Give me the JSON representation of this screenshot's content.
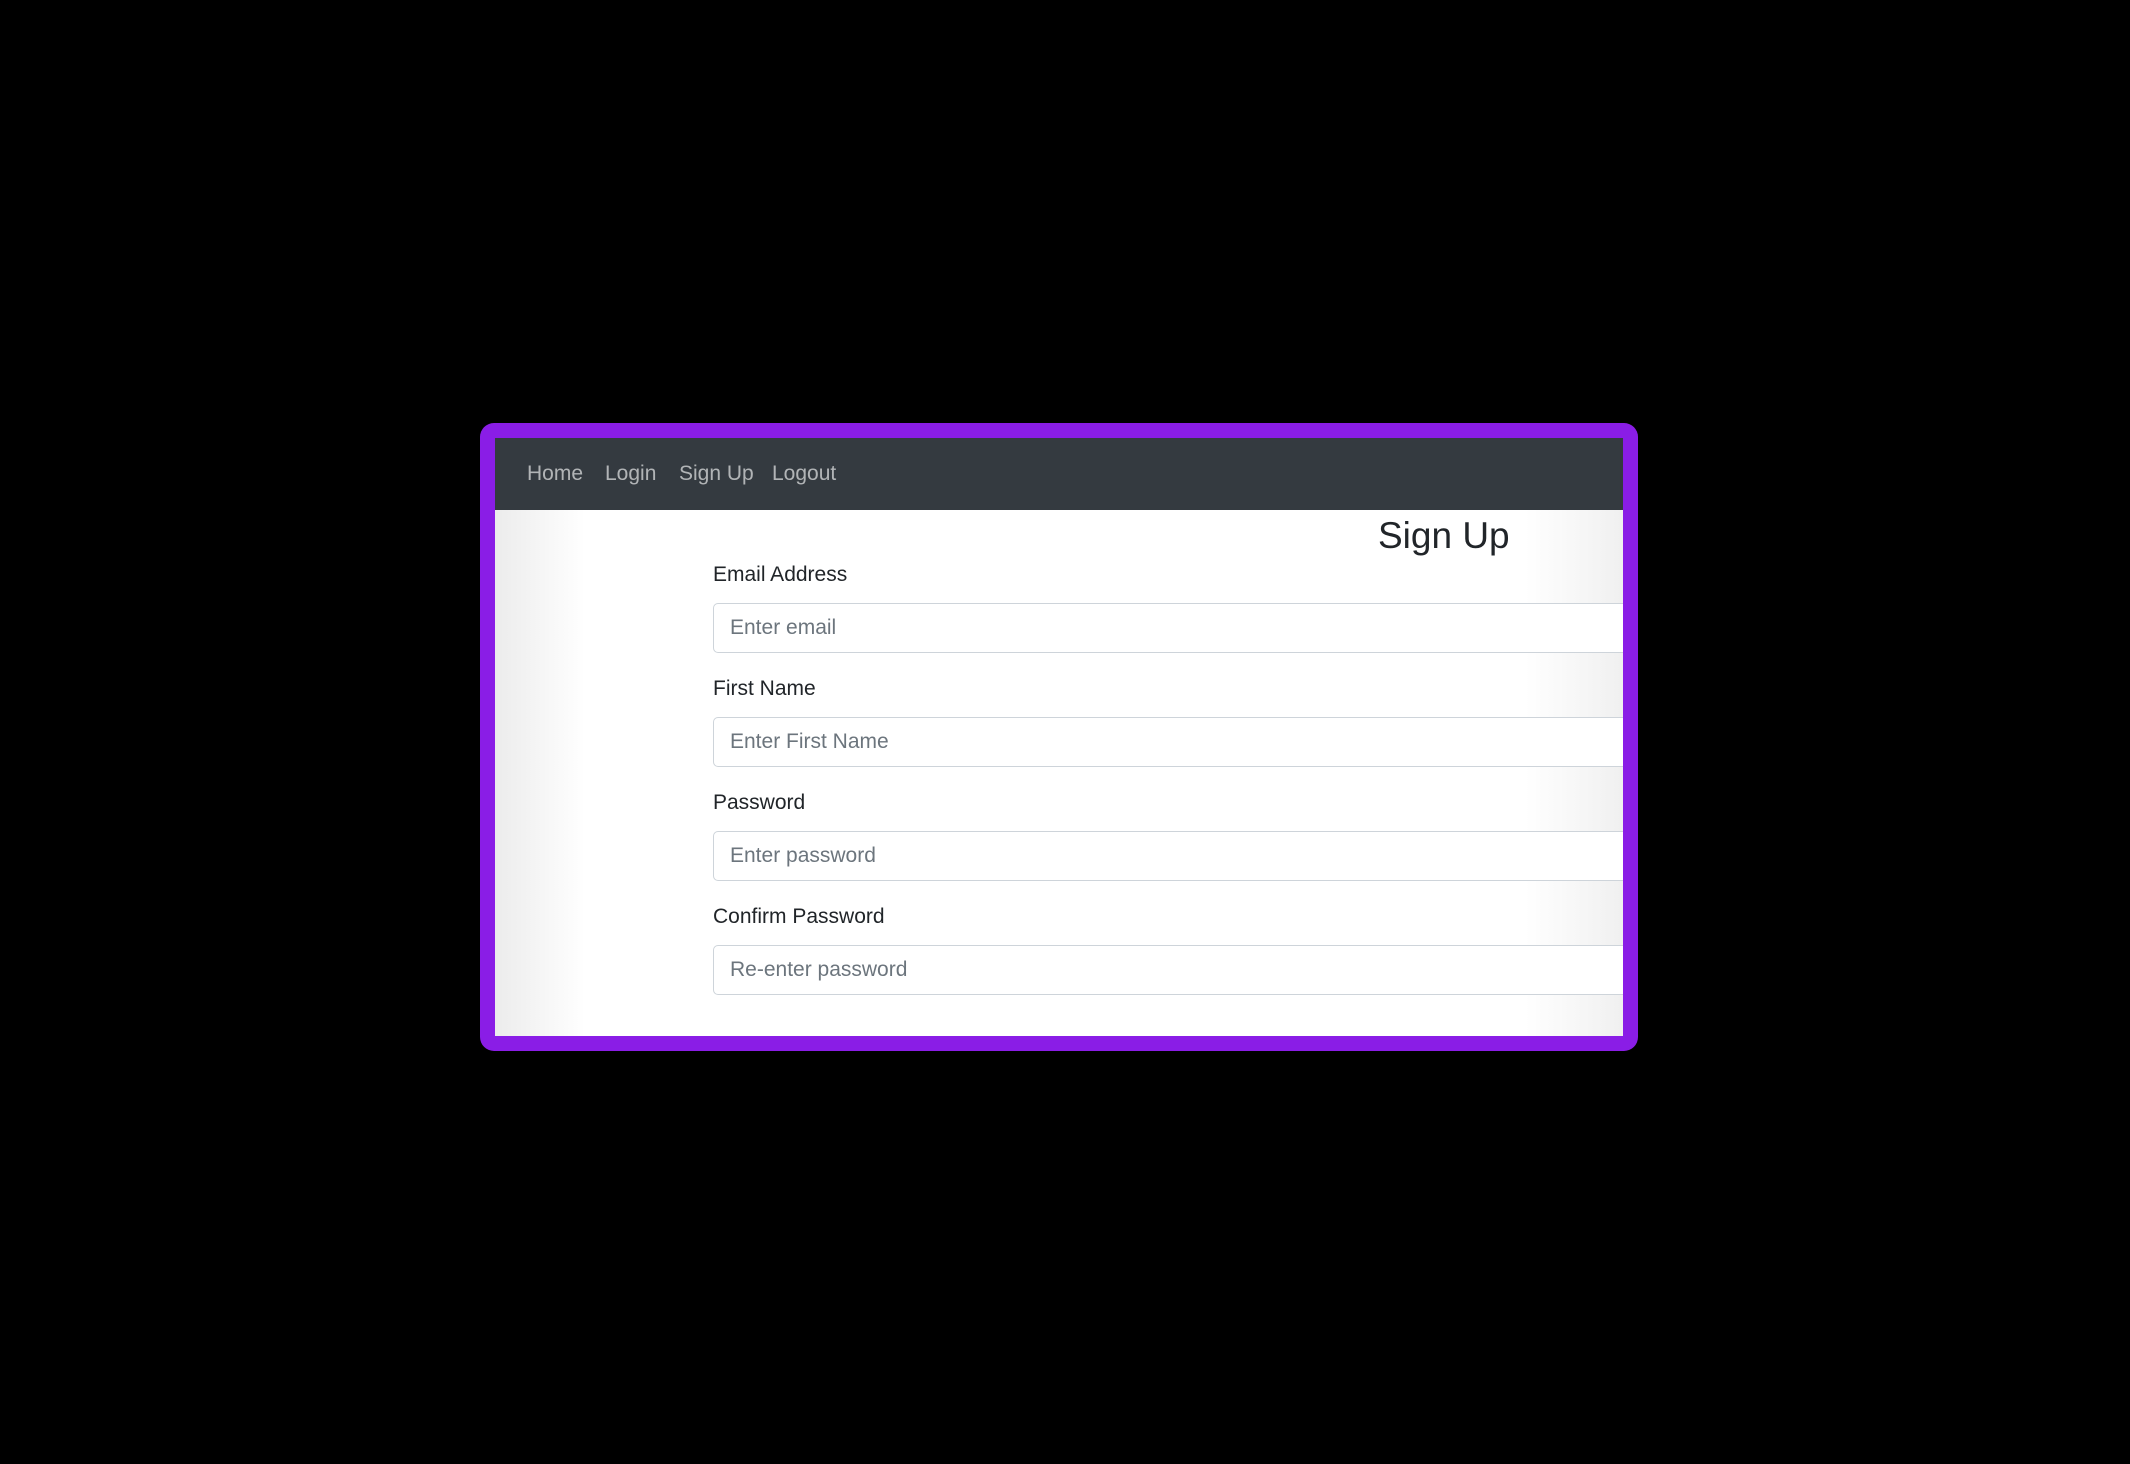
{
  "nav": {
    "items": [
      {
        "label": "Home"
      },
      {
        "label": "Login"
      },
      {
        "label": "Sign Up"
      },
      {
        "label": "Logout"
      }
    ]
  },
  "page": {
    "title": "Sign Up"
  },
  "form": {
    "email": {
      "label": "Email Address",
      "placeholder": "Enter email",
      "value": ""
    },
    "first_name": {
      "label": "First Name",
      "placeholder": "Enter First Name",
      "value": ""
    },
    "password": {
      "label": "Password",
      "placeholder": "Enter password",
      "value": ""
    },
    "confirm_password": {
      "label": "Confirm Password",
      "placeholder": "Re-enter password",
      "value": ""
    }
  },
  "colors": {
    "frame": "#8a1de6",
    "navbar": "#343a40",
    "background": "#000000"
  }
}
